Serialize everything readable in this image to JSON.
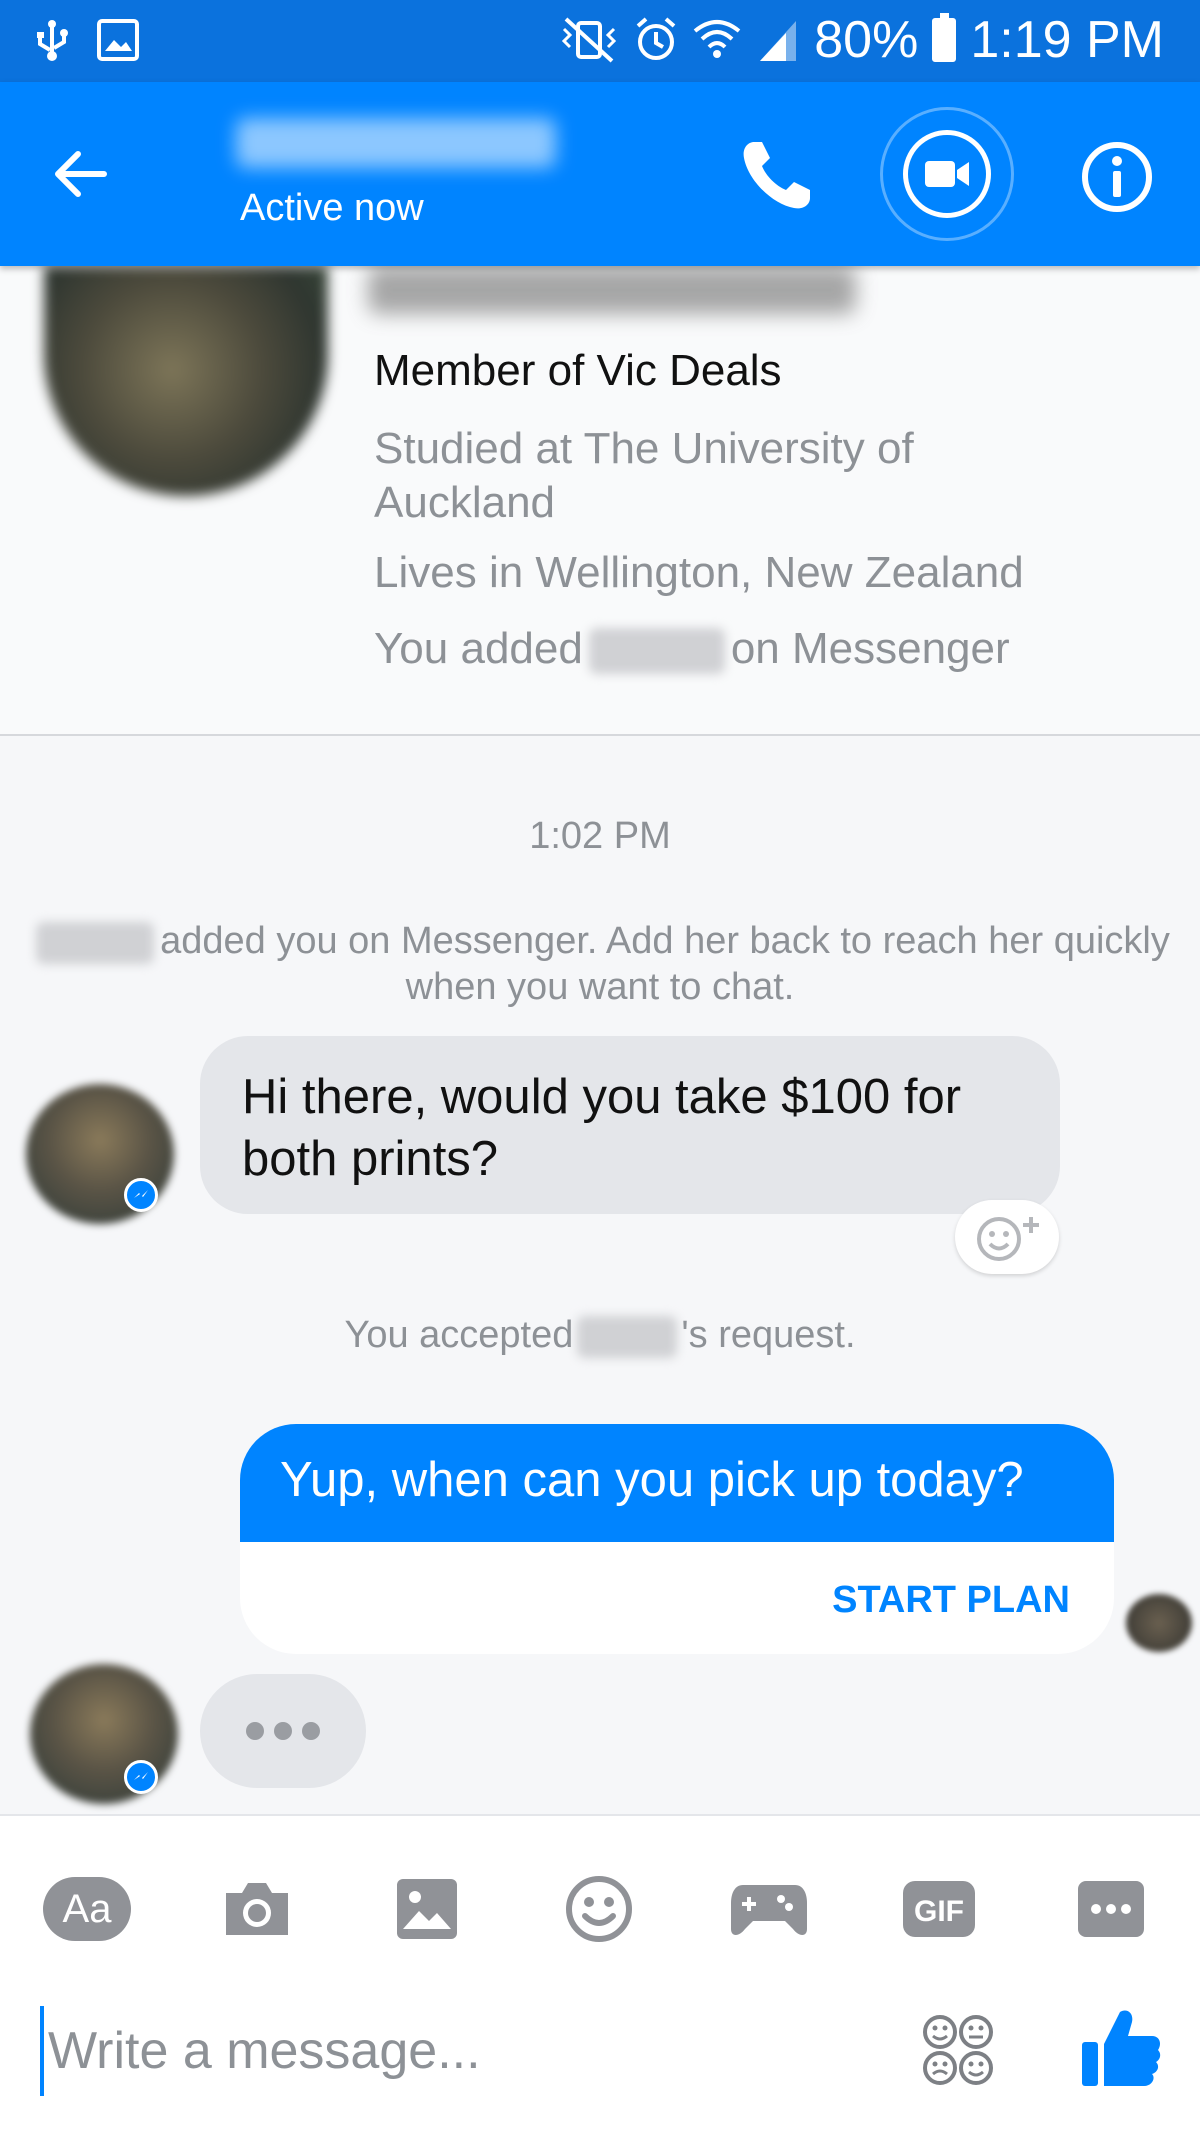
{
  "status_bar": {
    "battery": "80%",
    "time": "1:19 PM",
    "icons": [
      "usb-icon",
      "image-icon",
      "vibrate-mute-icon",
      "alarm-icon",
      "wifi-icon",
      "signal-icon",
      "battery-icon"
    ]
  },
  "header": {
    "status": "Active now",
    "icons": [
      "back-arrow-icon",
      "phone-icon",
      "video-camera-icon",
      "info-icon"
    ]
  },
  "profile": {
    "member": "Member of Vic Deals",
    "studied_line1": "Studied at The University of",
    "studied_line2": "Auckland",
    "lives": "Lives in Wellington, New Zealand",
    "added_prefix": "You added",
    "added_suffix": "on Messenger"
  },
  "conversation": {
    "timestamp": "1:02 PM",
    "system_added_text": "added you on Messenger. Add her back to reach her quickly",
    "system_added_text_line2": "when you want to chat.",
    "incoming_message_line1": "Hi there, would you take $100 for",
    "incoming_message_line2": "both prints?",
    "accepted_prefix": "You accepted",
    "accepted_suffix": "'s request.",
    "outgoing_message": "Yup, when can you pick up today?",
    "start_plan": "START PLAN"
  },
  "composer": {
    "aa_label": "Aa",
    "placeholder": "Write a message...",
    "toolbar_icons": [
      "text-format-icon",
      "camera-icon",
      "gallery-icon",
      "emoji-icon",
      "game-controller-icon",
      "gif-icon",
      "more-icon"
    ],
    "gif_label": "GIF"
  },
  "colors": {
    "status_bar": "#0b72dd",
    "app_bar": "#0084ff",
    "accent": "#0084ff",
    "incoming_bubble": "#e4e6ea",
    "muted_text": "#8d9196",
    "toolbar_icon": "#909297"
  }
}
